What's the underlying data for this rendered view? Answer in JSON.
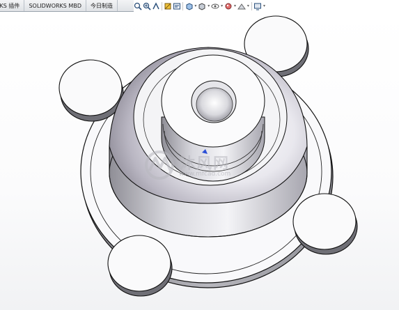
{
  "command_tabs": [
    "RKS 插件",
    "SOLIDWORKS MBD",
    "今日制造"
  ],
  "view_toolbar": {
    "icons": [
      "zoom-to-fit-icon",
      "zoom-area-icon",
      "previous-view-icon",
      "section-view-icon",
      "dynamic-annotation-icon",
      "view-orientation-icon",
      "display-style-icon",
      "hide-show-icon",
      "edit-appearance-icon",
      "apply-scene-icon",
      "view-settings-icon"
    ]
  },
  "watermark": {
    "site_name": "沐风网",
    "url": "www.mfcad.com"
  },
  "colors": {
    "watermark": "#b8b8bf",
    "part_face_light": "#f7f7f9",
    "part_edge": "#1a1a1a",
    "triad_blue": "#2b4fd6"
  }
}
